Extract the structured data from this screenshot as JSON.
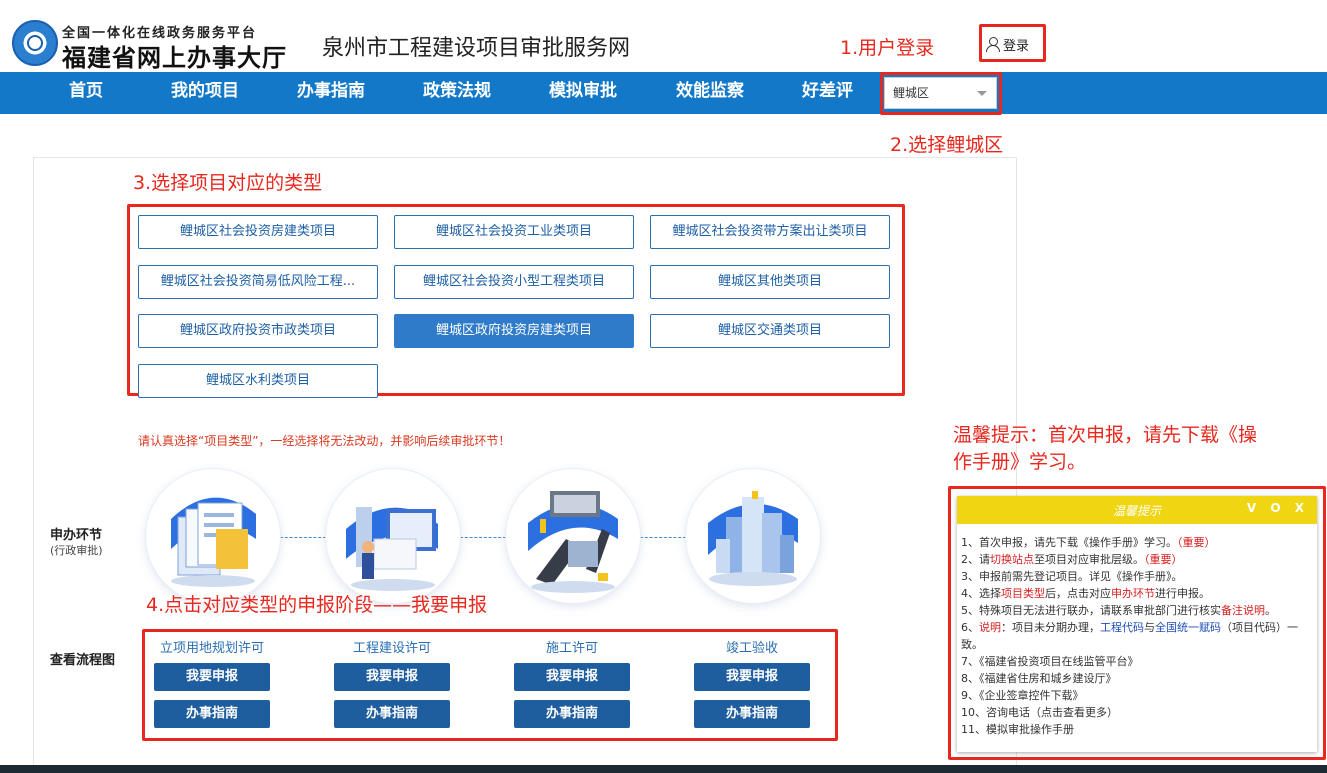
{
  "header": {
    "logo_small": "全国一体化在线政务服务平台",
    "logo_big": "福建省网上办事大厅",
    "site_title": "泉州市工程建设项目审批服务网",
    "login_label": "登录"
  },
  "annotations": {
    "step1": "1.用户登录",
    "step2": "2.选择鲤城区",
    "step3": "3.选择项目对应的类型",
    "step4": "4.点击对应类型的申报阶段——我要申报",
    "tips_hint": "温馨提示：首次申报，请先下载《操作手册》学习。"
  },
  "nav": {
    "items": [
      "首页",
      "我的项目",
      "办事指南",
      "政策法规",
      "模拟审批",
      "效能监察",
      "好差评"
    ],
    "district_selected": "鲤城区"
  },
  "project_types": [
    "鲤城区社会投资房建类项目",
    "鲤城区社会投资工业类项目",
    "鲤城区社会投资带方案出让类项目",
    "鲤城区社会投资简易低风险工程...",
    "鲤城区社会投资小型工程类项目",
    "鲤城区其他类项目",
    "鲤城区政府投资市政类项目",
    "鲤城区政府投资房建类项目",
    "鲤城区交通类项目",
    "鲤城区水利类项目"
  ],
  "warning": "请认真选择“项目类型”，一经选择将无法改动，并影响后续审批环节！",
  "process": {
    "label": "申办环节",
    "sublabel": "(行政审批)",
    "flow_label": "查看流程图",
    "stages": [
      {
        "title": "立项用地规划许可",
        "apply": "我要申报",
        "guide": "办事指南"
      },
      {
        "title": "工程建设许可",
        "apply": "我要申报",
        "guide": "办事指南"
      },
      {
        "title": "施工许可",
        "apply": "我要申报",
        "guide": "办事指南"
      },
      {
        "title": "竣工验收",
        "apply": "我要申报",
        "guide": "办事指南"
      }
    ]
  },
  "tips": {
    "title": "温馨提示",
    "controls": "V O X",
    "items": [
      {
        "n": "1、",
        "text": "首次申报，请先下载《操作手册》学习。",
        "tag": "（重要）"
      },
      {
        "n": "2、",
        "pre": "请",
        "red": "切换站点",
        "text": "至项目对应审批层级。",
        "tag": "（重要）"
      },
      {
        "n": "3、",
        "text": "申报前需先登记项目。详见《操作手册》。"
      },
      {
        "n": "4、",
        "pre": "选择",
        "red": "项目类型",
        "mid": "后，点击对应",
        "red2": "申办环节",
        "text": "进行申报。"
      },
      {
        "n": "5、",
        "text": "特殊项目无法进行联办，请联系审批部门进行核实",
        "red": "备注说明",
        "post": "。"
      },
      {
        "n": "6、",
        "red": "说明",
        "text": "：项目未分期办理，",
        "blue": "工程代码",
        "mid": "与",
        "blue2": "全国统一赋码",
        "post": "（项目代码）一致。"
      },
      {
        "n": "7、",
        "text": "《福建省投资项目在线监管平台》"
      },
      {
        "n": "8、",
        "text": "《福建省住房和城乡建设厅》"
      },
      {
        "n": "9、",
        "text": "《企业签章控件下载》"
      },
      {
        "n": "10、",
        "text": "咨询电话（点击查看更多）"
      },
      {
        "n": "11、",
        "text": "模拟审批操作手册"
      }
    ]
  },
  "colors": {
    "nav_bg": "#1378c7",
    "accent_red": "#e8281e",
    "tips_header": "#efd512",
    "button_dark": "#1f5e9e"
  }
}
